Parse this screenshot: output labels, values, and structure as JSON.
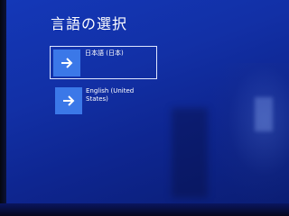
{
  "page": {
    "title": "言語の選択"
  },
  "languages": [
    {
      "label": "日本語 (日本)",
      "selected": true,
      "icon": "arrow-right-icon"
    },
    {
      "label": "English (United States)",
      "selected": false,
      "icon": "arrow-right-icon"
    }
  ],
  "colors": {
    "background": "#1230a6",
    "tile": "#3b78e8",
    "selection_border": "#dfe6ff",
    "text": "#ffffff"
  }
}
